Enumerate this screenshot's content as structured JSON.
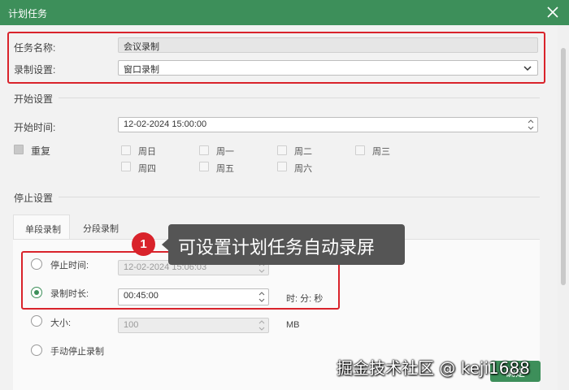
{
  "window": {
    "title": "计划任务",
    "close_icon": "close-icon"
  },
  "task": {
    "name_label": "任务名称:",
    "name_value": "会议录制",
    "record_setting_label": "录制设置:",
    "record_setting_value": "窗口录制"
  },
  "start": {
    "section_title": "开始设置",
    "time_label": "开始时间:",
    "time_value": "12-02-2024 15:00:00",
    "repeat_label": "重复",
    "days": [
      "周日",
      "周一",
      "周二",
      "周三",
      "周四",
      "周五",
      "周六"
    ]
  },
  "stop": {
    "section_title": "停止设置",
    "tabs": [
      "单段录制",
      "分段录制"
    ],
    "stop_time_label": "停止时间:",
    "stop_time_value": "12-02-2024 15:06:03",
    "duration_label": "录制时长:",
    "duration_value": "00:45:00",
    "duration_unit": "时: 分: 秒",
    "size_label": "大小:",
    "size_value": "100",
    "size_unit": "MB",
    "manual_label": "手动停止录制"
  },
  "callout": {
    "badge": "1",
    "text": "可设置计划任务自动录屏"
  },
  "footer": {
    "ok_label": "确定"
  },
  "watermark": "掘金技术社区 @ keji1688",
  "colors": {
    "accent": "#3d8f5a",
    "highlight": "#d9232b"
  }
}
